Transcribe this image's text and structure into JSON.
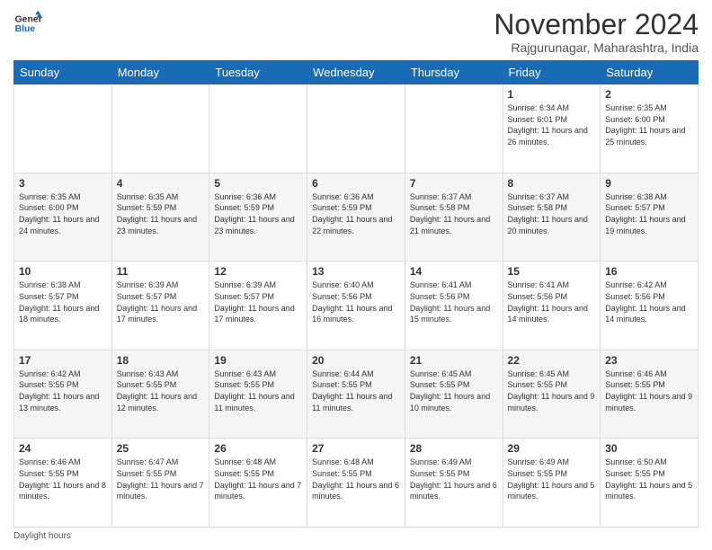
{
  "header": {
    "logo_line1": "General",
    "logo_line2": "Blue",
    "month_title": "November 2024",
    "location": "Rajgurunagar, Maharashtra, India"
  },
  "days_of_week": [
    "Sunday",
    "Monday",
    "Tuesday",
    "Wednesday",
    "Thursday",
    "Friday",
    "Saturday"
  ],
  "weeks": [
    [
      {
        "day": "",
        "info": ""
      },
      {
        "day": "",
        "info": ""
      },
      {
        "day": "",
        "info": ""
      },
      {
        "day": "",
        "info": ""
      },
      {
        "day": "",
        "info": ""
      },
      {
        "day": "1",
        "info": "Sunrise: 6:34 AM\nSunset: 6:01 PM\nDaylight: 11 hours and 26 minutes."
      },
      {
        "day": "2",
        "info": "Sunrise: 6:35 AM\nSunset: 6:00 PM\nDaylight: 11 hours and 25 minutes."
      }
    ],
    [
      {
        "day": "3",
        "info": "Sunrise: 6:35 AM\nSunset: 6:00 PM\nDaylight: 11 hours and 24 minutes."
      },
      {
        "day": "4",
        "info": "Sunrise: 6:35 AM\nSunset: 5:59 PM\nDaylight: 11 hours and 23 minutes."
      },
      {
        "day": "5",
        "info": "Sunrise: 6:36 AM\nSunset: 5:59 PM\nDaylight: 11 hours and 23 minutes."
      },
      {
        "day": "6",
        "info": "Sunrise: 6:36 AM\nSunset: 5:59 PM\nDaylight: 11 hours and 22 minutes."
      },
      {
        "day": "7",
        "info": "Sunrise: 6:37 AM\nSunset: 5:58 PM\nDaylight: 11 hours and 21 minutes."
      },
      {
        "day": "8",
        "info": "Sunrise: 6:37 AM\nSunset: 5:58 PM\nDaylight: 11 hours and 20 minutes."
      },
      {
        "day": "9",
        "info": "Sunrise: 6:38 AM\nSunset: 5:57 PM\nDaylight: 11 hours and 19 minutes."
      }
    ],
    [
      {
        "day": "10",
        "info": "Sunrise: 6:38 AM\nSunset: 5:57 PM\nDaylight: 11 hours and 18 minutes."
      },
      {
        "day": "11",
        "info": "Sunrise: 6:39 AM\nSunset: 5:57 PM\nDaylight: 11 hours and 17 minutes."
      },
      {
        "day": "12",
        "info": "Sunrise: 6:39 AM\nSunset: 5:57 PM\nDaylight: 11 hours and 17 minutes."
      },
      {
        "day": "13",
        "info": "Sunrise: 6:40 AM\nSunset: 5:56 PM\nDaylight: 11 hours and 16 minutes."
      },
      {
        "day": "14",
        "info": "Sunrise: 6:41 AM\nSunset: 5:56 PM\nDaylight: 11 hours and 15 minutes."
      },
      {
        "day": "15",
        "info": "Sunrise: 6:41 AM\nSunset: 5:56 PM\nDaylight: 11 hours and 14 minutes."
      },
      {
        "day": "16",
        "info": "Sunrise: 6:42 AM\nSunset: 5:56 PM\nDaylight: 11 hours and 14 minutes."
      }
    ],
    [
      {
        "day": "17",
        "info": "Sunrise: 6:42 AM\nSunset: 5:55 PM\nDaylight: 11 hours and 13 minutes."
      },
      {
        "day": "18",
        "info": "Sunrise: 6:43 AM\nSunset: 5:55 PM\nDaylight: 11 hours and 12 minutes."
      },
      {
        "day": "19",
        "info": "Sunrise: 6:43 AM\nSunset: 5:55 PM\nDaylight: 11 hours and 11 minutes."
      },
      {
        "day": "20",
        "info": "Sunrise: 6:44 AM\nSunset: 5:55 PM\nDaylight: 11 hours and 11 minutes."
      },
      {
        "day": "21",
        "info": "Sunrise: 6:45 AM\nSunset: 5:55 PM\nDaylight: 11 hours and 10 minutes."
      },
      {
        "day": "22",
        "info": "Sunrise: 6:45 AM\nSunset: 5:55 PM\nDaylight: 11 hours and 9 minutes."
      },
      {
        "day": "23",
        "info": "Sunrise: 6:46 AM\nSunset: 5:55 PM\nDaylight: 11 hours and 9 minutes."
      }
    ],
    [
      {
        "day": "24",
        "info": "Sunrise: 6:46 AM\nSunset: 5:55 PM\nDaylight: 11 hours and 8 minutes."
      },
      {
        "day": "25",
        "info": "Sunrise: 6:47 AM\nSunset: 5:55 PM\nDaylight: 11 hours and 7 minutes."
      },
      {
        "day": "26",
        "info": "Sunrise: 6:48 AM\nSunset: 5:55 PM\nDaylight: 11 hours and 7 minutes."
      },
      {
        "day": "27",
        "info": "Sunrise: 6:48 AM\nSunset: 5:55 PM\nDaylight: 11 hours and 6 minutes."
      },
      {
        "day": "28",
        "info": "Sunrise: 6:49 AM\nSunset: 5:55 PM\nDaylight: 11 hours and 6 minutes."
      },
      {
        "day": "29",
        "info": "Sunrise: 6:49 AM\nSunset: 5:55 PM\nDaylight: 11 hours and 5 minutes."
      },
      {
        "day": "30",
        "info": "Sunrise: 6:50 AM\nSunset: 5:55 PM\nDaylight: 11 hours and 5 minutes."
      }
    ]
  ],
  "footer": {
    "daylight_label": "Daylight hours"
  }
}
